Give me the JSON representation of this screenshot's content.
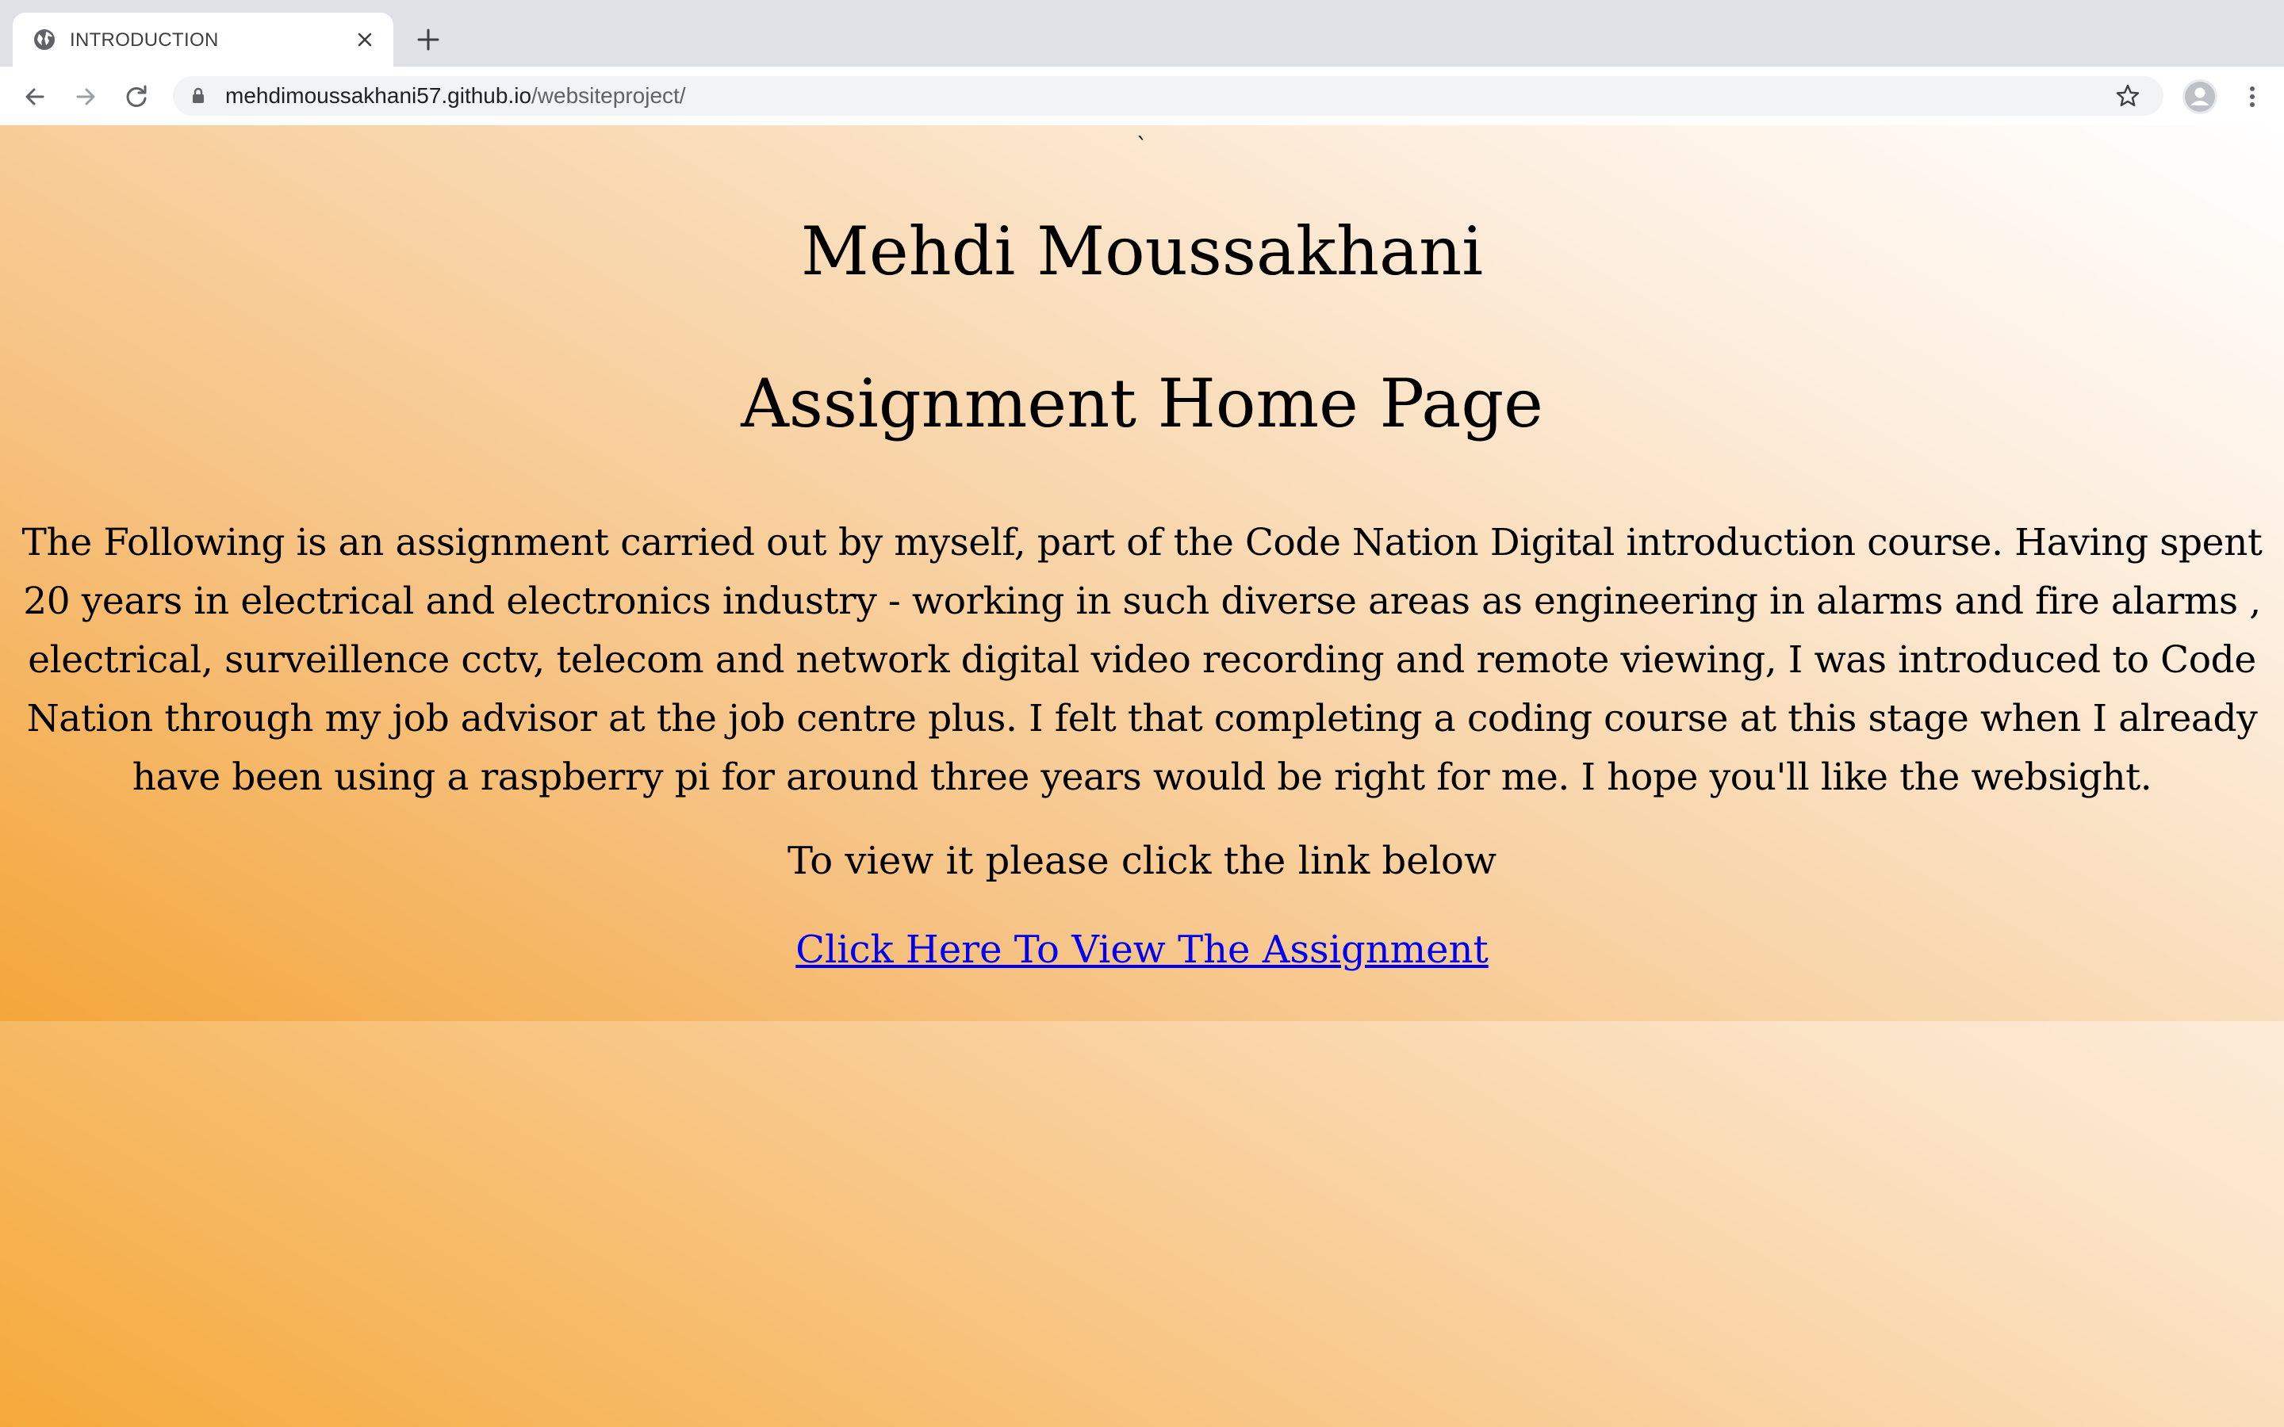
{
  "browser": {
    "tab_title": "INTRODUCTION",
    "url_host": "mehdimoussakhani57.github.io",
    "url_path": "/websiteproject/",
    "icons": [
      "globe-icon",
      "close-icon",
      "plus-icon",
      "back-arrow-icon",
      "forward-arrow-icon",
      "reload-icon",
      "lock-icon",
      "star-icon",
      "avatar-icon",
      "more-vertical-icon"
    ]
  },
  "page": {
    "stray_char": "`",
    "name_heading": "Mehdi Moussakhani",
    "sub_heading": "Assignment Home Page",
    "intro": "The Following is an assignment carried out by myself, part of the Code Nation Digital introduction course. Having spent 20 years in electrical and electronics industry - working in such diverse areas as engineering in alarms and fire alarms , electrical, surveillence cctv, telecom and network digital video recording and remote viewing, I was introduced to Code Nation through my job advisor at the job centre plus. I felt that completing a coding course at this stage when I already have been using a raspberry pi for around three years would be right for me. I hope you'll like the websight.",
    "prompt": "To view it please click the link below",
    "link_text": "Click Here To View The Assignment",
    "colors": {
      "gradient_warm": "#f5a93a",
      "gradient_light": "#ffffff",
      "link": "#0000ee"
    }
  }
}
